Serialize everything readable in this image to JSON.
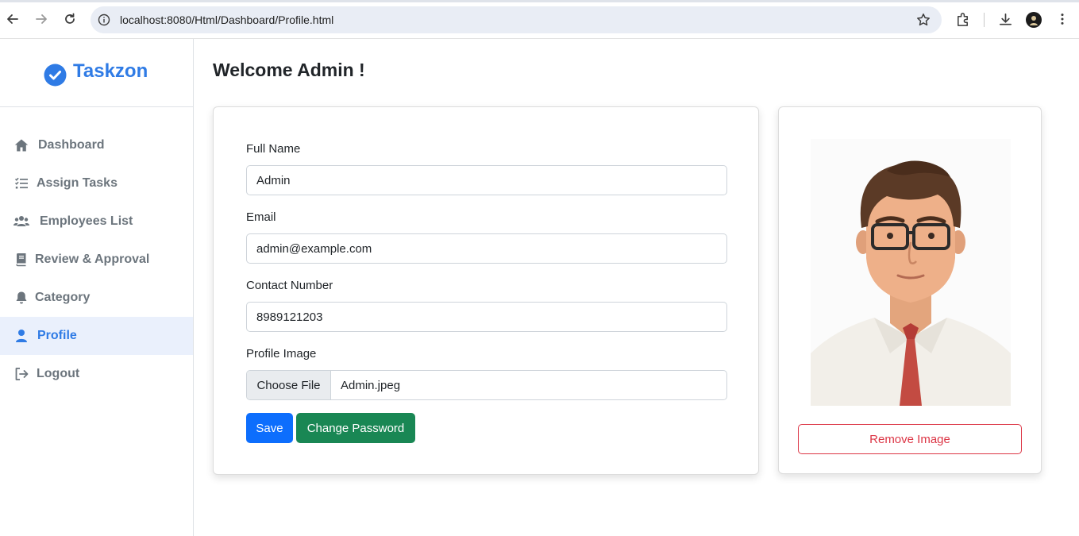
{
  "browser": {
    "url": "localhost:8080/Html/Dashboard/Profile.html",
    "icons": [
      "back-arrow-icon",
      "forward-arrow-icon",
      "reload-icon",
      "site-info-icon",
      "bookmark-star-icon",
      "extensions-icon",
      "download-icon",
      "profile-avatar-icon",
      "more-menu-icon"
    ]
  },
  "brand": {
    "name": "Taskzon",
    "icon": "check-circle-icon",
    "color": "#2f7be5"
  },
  "sidebar": {
    "items": [
      {
        "label": "Dashboard",
        "icon": "home-icon"
      },
      {
        "label": "Assign Tasks",
        "icon": "task-list-icon"
      },
      {
        "label": "Employees List",
        "icon": "users-icon"
      },
      {
        "label": "Review & Approval",
        "icon": "book-icon"
      },
      {
        "label": "Category",
        "icon": "bell-icon"
      },
      {
        "label": "Profile",
        "icon": "user-icon",
        "active": true
      },
      {
        "label": "Logout",
        "icon": "logout-icon"
      }
    ]
  },
  "main": {
    "title": "Welcome Admin !",
    "form": {
      "full_name_label": "Full Name",
      "full_name_value": "Admin",
      "email_label": "Email",
      "email_value": "admin@example.com",
      "contact_label": "Contact Number",
      "contact_value": "8989121203",
      "image_label": "Profile Image",
      "file_button": "Choose File",
      "file_name": "Admin.jpeg",
      "save_label": "Save",
      "change_password_label": "Change Password"
    },
    "image_card": {
      "remove_label": "Remove Image"
    }
  },
  "colors": {
    "primary": "#0d6efd",
    "success": "#198754",
    "danger": "#dc3545",
    "muted": "#6c757d",
    "active_bg": "#eaf0fc"
  }
}
